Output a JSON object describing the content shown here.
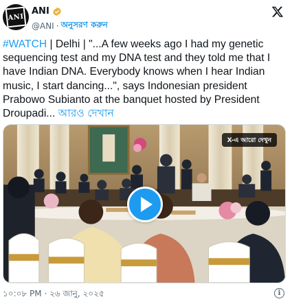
{
  "author": {
    "name": "ANI",
    "handle": "@ANI",
    "separator": "·",
    "follow_label": "অনুসরণ করুন",
    "avatar_text": "ANI",
    "verified_color": "#e8b43d"
  },
  "tweet": {
    "hashtag": "#WATCH",
    "body": " | Delhi | \"...A few weeks ago I had my genetic sequencing test and my DNA test and they told me that I have Indian DNA. Everybody knows when I hear Indian music, I start dancing...\", says Indonesian president Prabowo Subianto at the banquet hosted by President Droupadi... ",
    "show_more": "আরও দেখান"
  },
  "media": {
    "watch_more_label": "X-এ আরো দেখুন",
    "play_icon": "play-icon"
  },
  "footer": {
    "timestamp": "১০:০৮ PM · ২৬ জানু, ২০২৫",
    "info_icon": "info-icon"
  },
  "colors": {
    "accent": "#1d9bf0",
    "text": "#0f1419",
    "secondary": "#536471"
  }
}
